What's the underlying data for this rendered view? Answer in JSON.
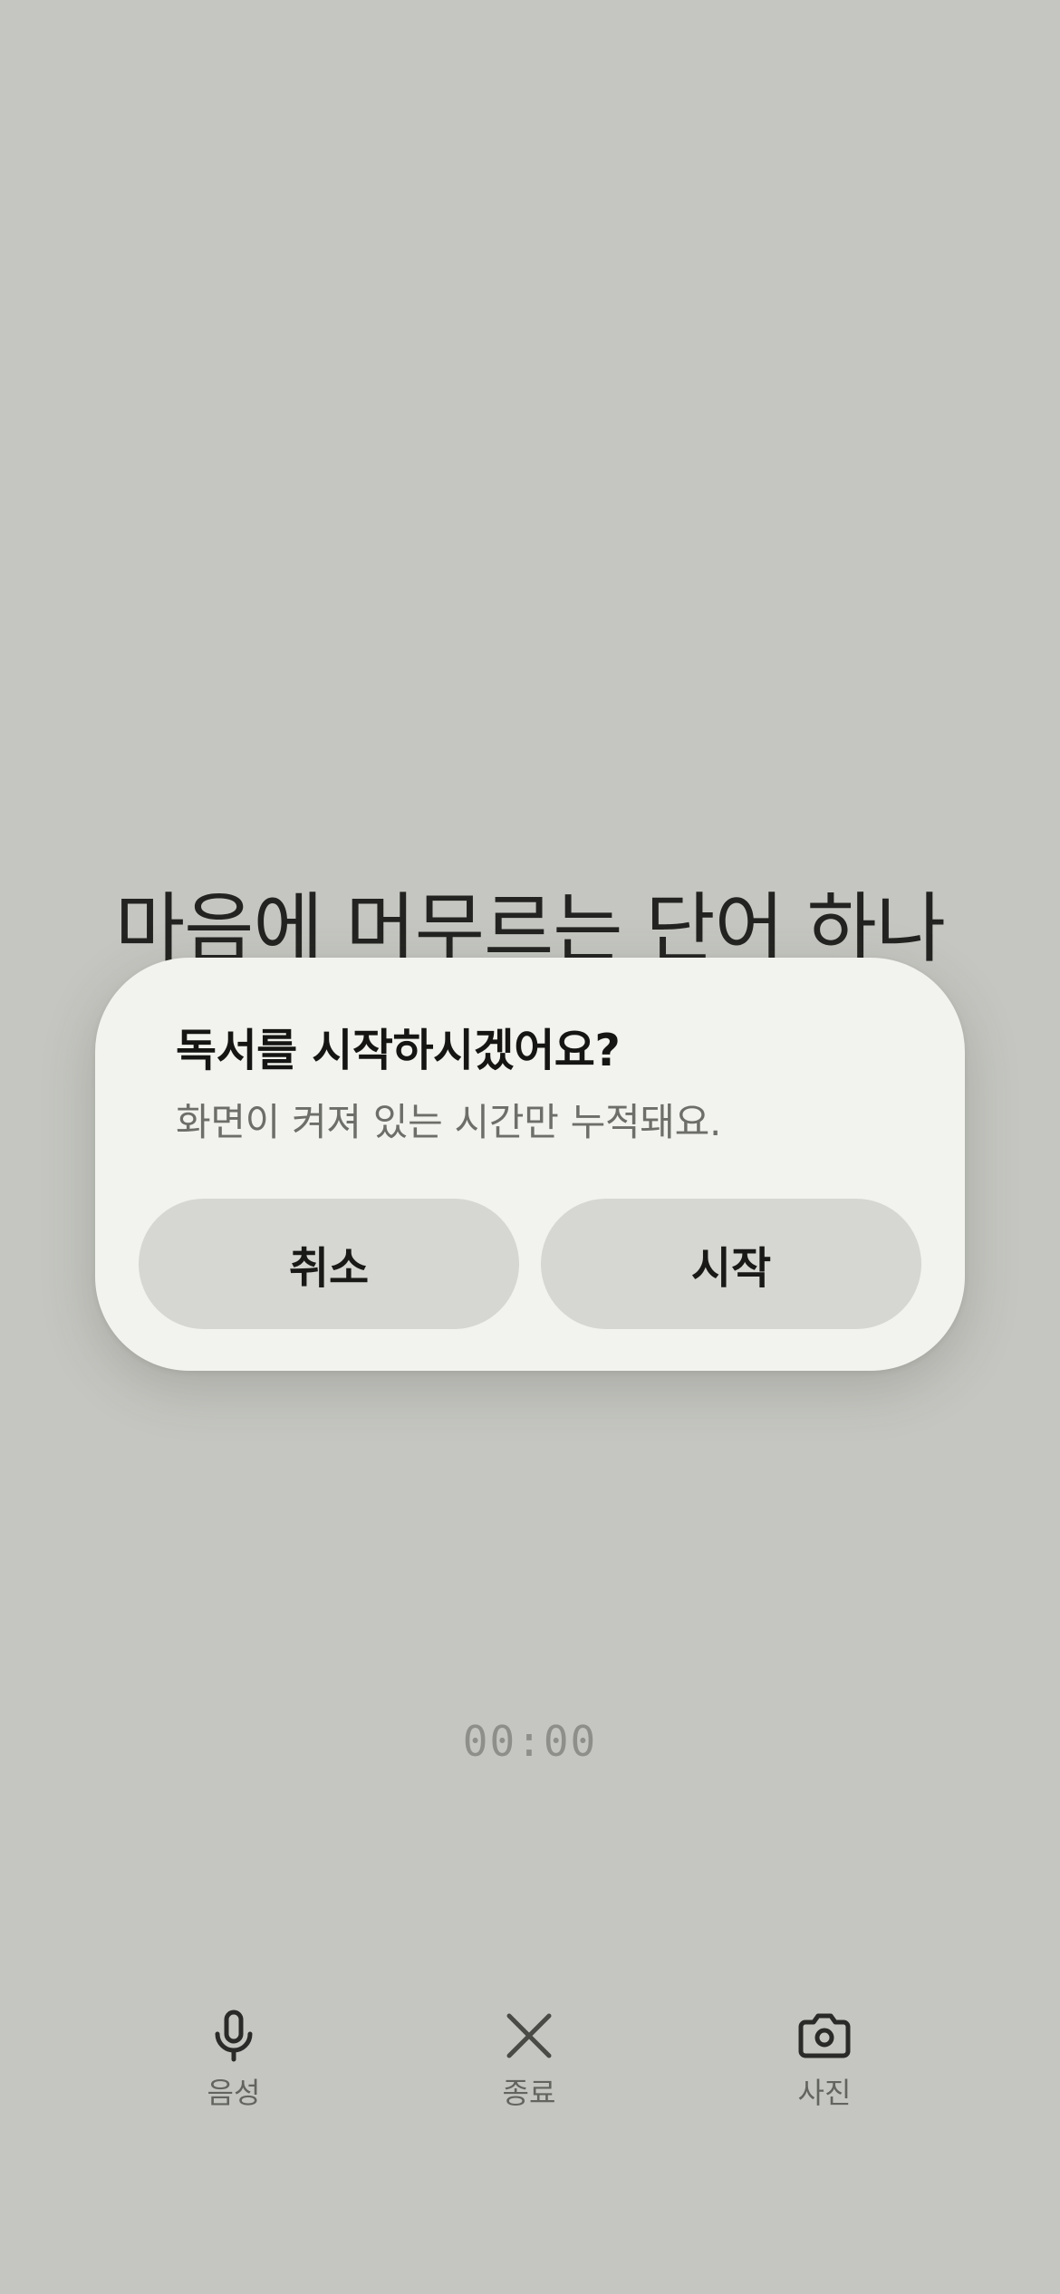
{
  "reading": {
    "prompt": "마음에 머무르는 단어 하나",
    "timer": "00:00"
  },
  "toolbar": {
    "voice": {
      "label": "음성",
      "icon": "microphone-icon"
    },
    "end": {
      "label": "종료",
      "icon": "close-icon"
    },
    "photo": {
      "label": "사진",
      "icon": "camera-icon"
    }
  },
  "dialog": {
    "title": "독서를 시작하시겠어요?",
    "message": "화면이 켜져 있는 시간만 누적돼요.",
    "cancel_label": "취소",
    "start_label": "시작"
  },
  "colors": {
    "background": "#c5c6c1",
    "dialog_surface": "#f2f2ee",
    "button_fill": "#d6d6d2"
  }
}
